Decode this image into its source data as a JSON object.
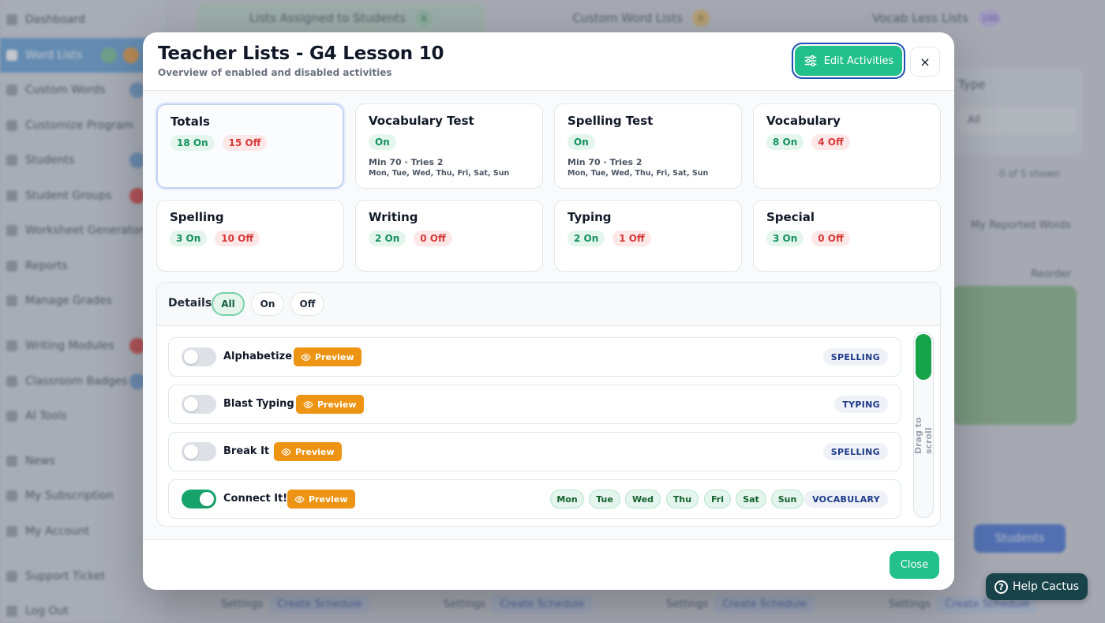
{
  "background": {
    "sidebar": [
      "Dashboard",
      "Word Lists",
      "Custom Words",
      "Customize Program",
      "Students",
      "Student Groups",
      "Worksheet Generator",
      "Reports",
      "Manage Grades",
      "Writing Modules",
      "Classroom Badges",
      "AI Tools",
      "News",
      "My Subscription",
      "My Account",
      "Support Ticket",
      "Log Out"
    ],
    "tabs": [
      {
        "label": "Lists Assigned to Students",
        "count": "8"
      },
      {
        "label": "Custom Word Lists",
        "count": "0"
      },
      {
        "label": "Vocab Less Lists",
        "count": "100"
      }
    ],
    "right_panel": {
      "type_label": "Type",
      "select_value": "All",
      "shown_text": "0 of 5 shown",
      "reported_text": "My Reported Words",
      "reorder_text": "Reorder",
      "students_button": "Students"
    },
    "footer_settings": "Settings",
    "footer_schedule": "Create Schedule"
  },
  "modal": {
    "title": "Teacher Lists - G4 Lesson 10",
    "subtitle": "Overview of enabled and disabled activities",
    "edit_button": "Edit Activities",
    "close_icon": "×",
    "close_button": "Close"
  },
  "stats": {
    "totals": {
      "title": "Totals",
      "on": "18 On",
      "off": "15 Off"
    },
    "vocab_test": {
      "title": "Vocabulary Test",
      "status": "On",
      "meta": "Min 70 · Tries 2",
      "days": "Mon, Tue, Wed, Thu, Fri, Sat, Sun"
    },
    "spelling_test": {
      "title": "Spelling Test",
      "status": "On",
      "meta": "Min 70 · Tries 2",
      "days": "Mon, Tue, Wed, Thu, Fri, Sat, Sun"
    },
    "vocabulary": {
      "title": "Vocabulary",
      "on": "8 On",
      "off": "4 Off"
    },
    "spelling": {
      "title": "Spelling",
      "on": "3 On",
      "off": "10 Off"
    },
    "writing": {
      "title": "Writing",
      "on": "2 On",
      "off": "0 Off"
    },
    "typing": {
      "title": "Typing",
      "on": "2 On",
      "off": "1 Off"
    },
    "special": {
      "title": "Special",
      "on": "3 On",
      "off": "0 Off"
    }
  },
  "details": {
    "label": "Details",
    "filters": {
      "all": "All",
      "on": "On",
      "off": "Off"
    },
    "preview_label": "Preview",
    "scroll_hint": "Drag to scroll",
    "activities": [
      {
        "name": "Alphabetize",
        "category": "SPELLING"
      },
      {
        "name": "Blast Typing",
        "category": "TYPING"
      },
      {
        "name": "Break It",
        "category": "SPELLING"
      },
      {
        "name": "Connect It!",
        "category": "VOCABULARY",
        "days": [
          "Mon",
          "Tue",
          "Wed",
          "Thu",
          "Fri",
          "Sat",
          "Sun"
        ]
      }
    ]
  },
  "help": {
    "label": "Help Cactus",
    "icon": "?"
  }
}
